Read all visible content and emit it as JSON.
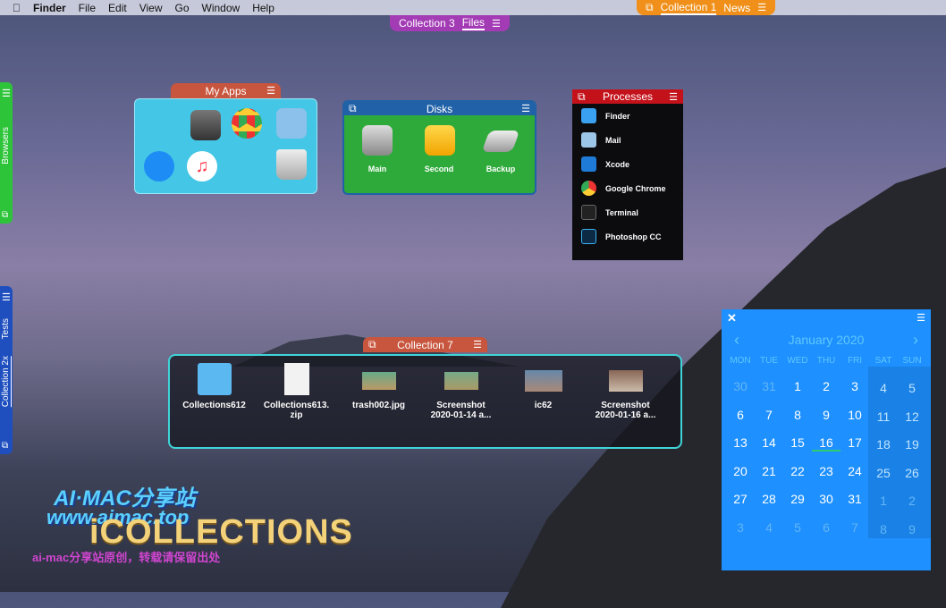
{
  "menubar": {
    "app": "Finder",
    "items": [
      "File",
      "Edit",
      "View",
      "Go",
      "Window",
      "Help"
    ]
  },
  "top_tabs": [
    {
      "collection": "Collection 3",
      "selected": "Files",
      "color": "#a33bb5"
    },
    {
      "collection": "Collection 1",
      "selected": "News",
      "color": "#f0901a"
    }
  ],
  "side_tabs": [
    {
      "label": "Browsers",
      "color": "#2ec43a"
    },
    {
      "collection": "Collection 2x",
      "label": "Tests",
      "color": "#1f4fbf"
    }
  ],
  "my_apps": {
    "title": "My Apps",
    "apps": [
      "calculator",
      "chrome",
      "preview",
      "messages",
      "music",
      "trash"
    ]
  },
  "disks": {
    "title": "Disks",
    "items": [
      "Main",
      "Second",
      "Backup"
    ]
  },
  "processes": {
    "title": "Processes",
    "items": [
      "Finder",
      "Mail",
      "Xcode",
      "Google Chrome",
      "Terminal",
      "Photoshop CC"
    ]
  },
  "collection7": {
    "title": "Collection 7",
    "files": [
      [
        "Collections612"
      ],
      [
        "Collections613.",
        "zip"
      ],
      [
        "trash002.jpg"
      ],
      [
        "Screenshot",
        "2020-01-14 a..."
      ],
      [
        "ic62"
      ],
      [
        "Screenshot",
        "2020-01-16 a..."
      ]
    ]
  },
  "calendar": {
    "title": "January 2020",
    "weekdays": [
      "MON",
      "TUE",
      "WED",
      "THU",
      "FRI",
      "SAT",
      "SUN"
    ],
    "weeks": [
      [
        30,
        31,
        1,
        2,
        3,
        4,
        5
      ],
      [
        6,
        7,
        8,
        9,
        10,
        11,
        12
      ],
      [
        13,
        14,
        15,
        16,
        17,
        18,
        19
      ],
      [
        20,
        21,
        22,
        23,
        24,
        25,
        26
      ],
      [
        27,
        28,
        29,
        30,
        31,
        1,
        2
      ],
      [
        3,
        4,
        5,
        6,
        7,
        8,
        9
      ]
    ],
    "today": 16
  },
  "watermark": {
    "line1": "AI·MAC分享站",
    "line2": "www.aimac.top",
    "logo": "iCOLLECTIONS",
    "line3": "ai-mac分享站原创，转载请保留出处"
  }
}
